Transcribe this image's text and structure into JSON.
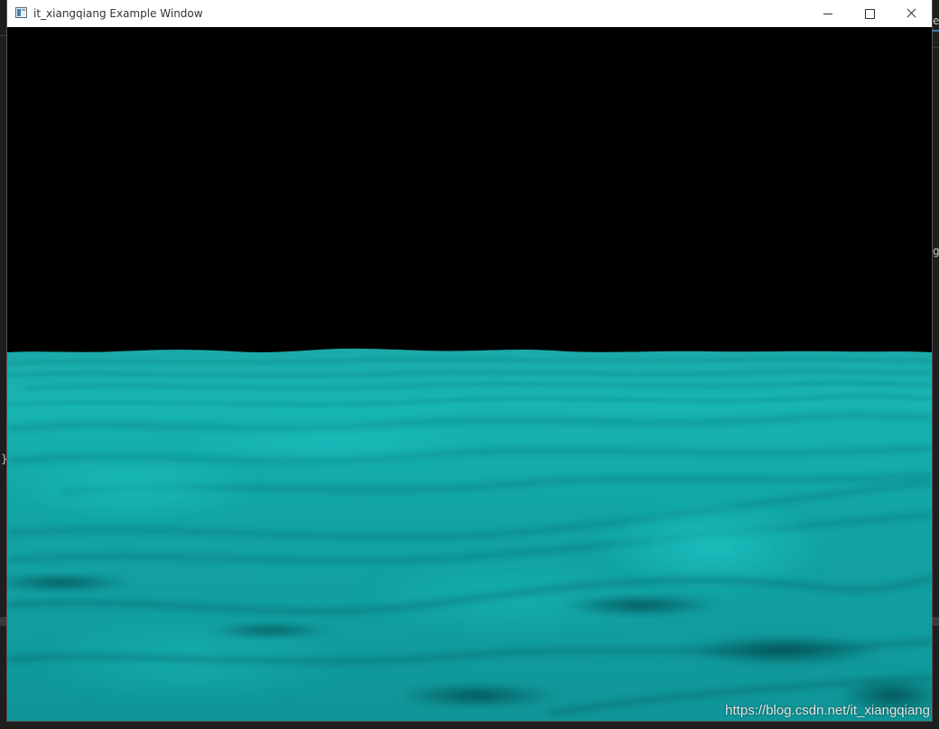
{
  "window": {
    "title": "it_xiangqiang Example Window"
  },
  "icons": {
    "app": "app-window-icon",
    "minimize": "minimize-icon",
    "maximize": "maximize-icon",
    "close": "close-icon"
  },
  "scene": {
    "sky_color": "#000000",
    "water_color": "#12b0b0",
    "water_dark": "#0a5c60",
    "water_light": "#21c9c4"
  },
  "watermark": "https://blog.csdn.net/it_xiangqiang",
  "background_fragments": {
    "right_top": "ex",
    "right_mid": "g",
    "left_mid": "}"
  }
}
